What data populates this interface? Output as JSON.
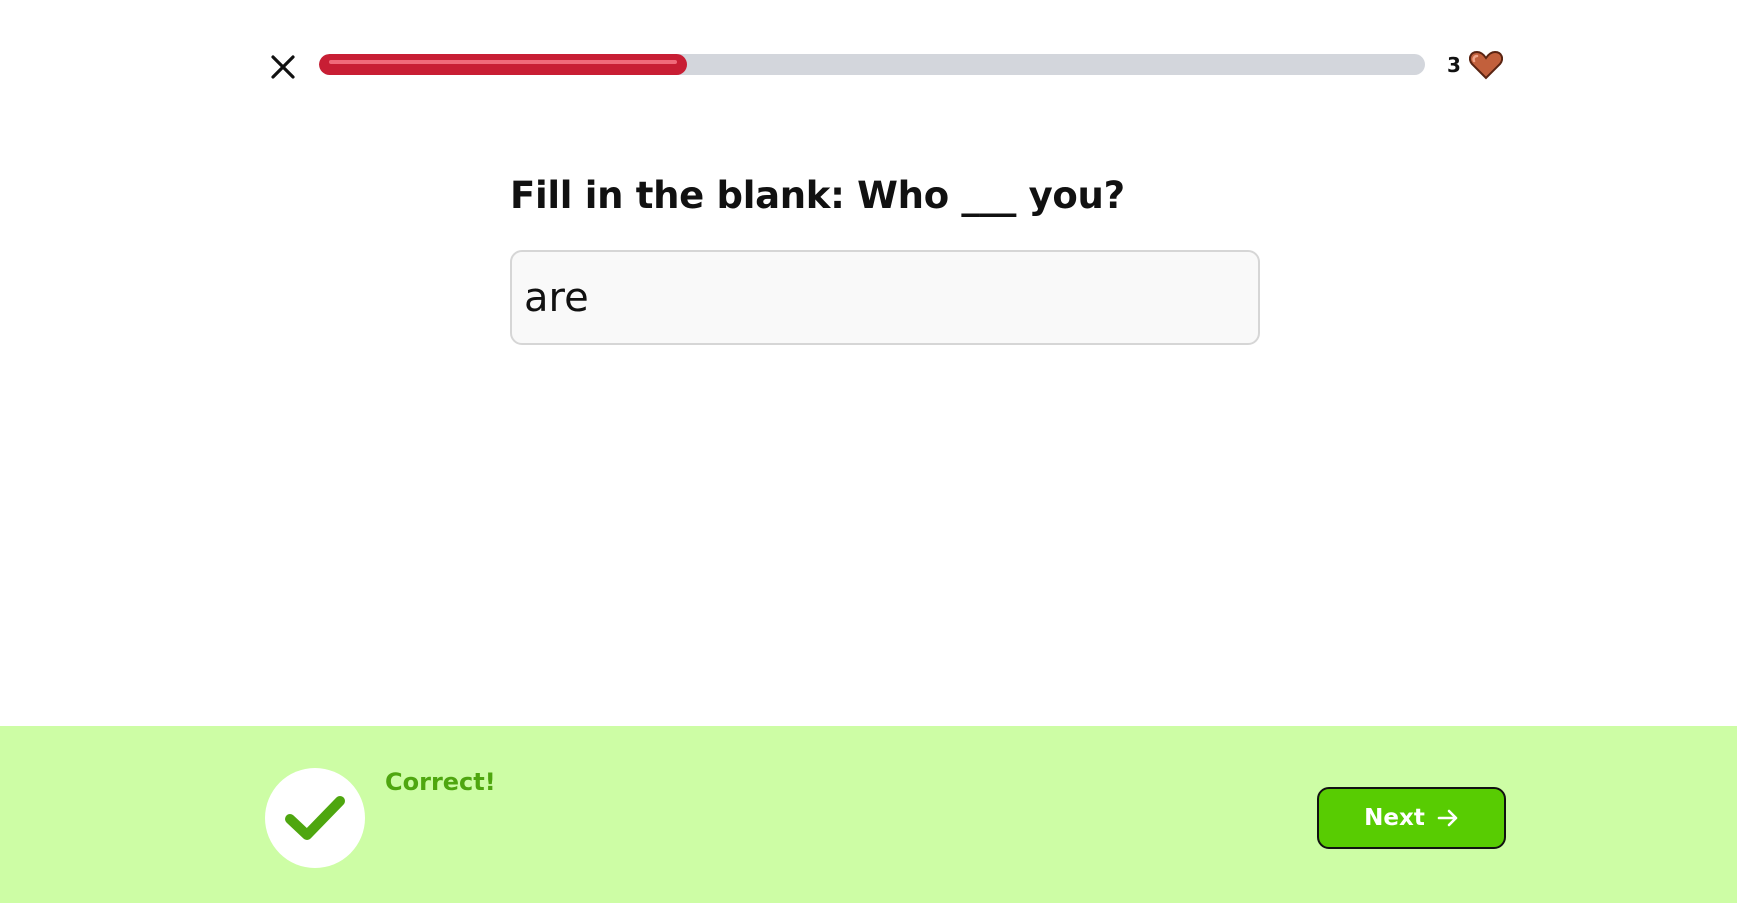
{
  "header": {
    "close_icon": "close-icon",
    "progress_fraction": 0.333,
    "progress_color": "#c81e34",
    "hearts_count": "3",
    "heart_icon": "heart-icon"
  },
  "exercise": {
    "question": "Fill in the blank: Who ___ you?",
    "answer_value": "are"
  },
  "feedback": {
    "status_icon": "check-icon",
    "message": "Correct!",
    "next_label": "Next",
    "next_icon": "arrow-right-icon",
    "background_color": "#cdfda5",
    "accent_color": "#58cc02"
  }
}
